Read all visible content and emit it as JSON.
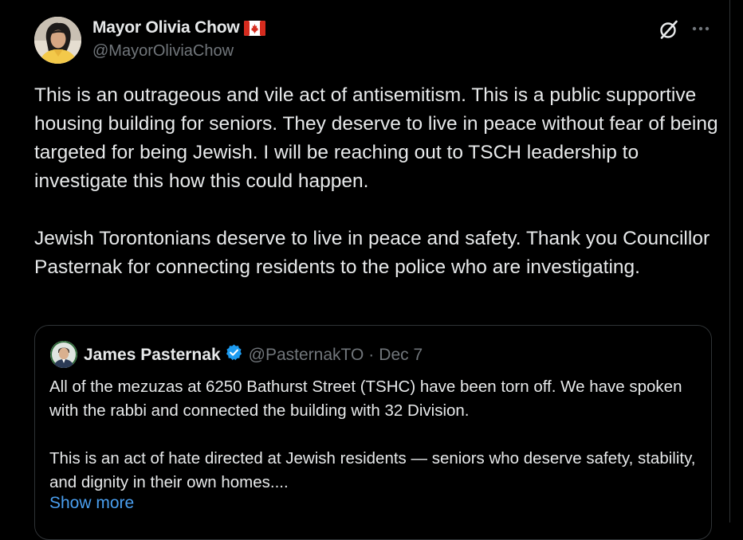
{
  "author": {
    "display_name": "Mayor Olivia Chow",
    "flag_emoji": "canada-flag-icon",
    "handle": "@MayorOliviaChow"
  },
  "tweet": {
    "paragraphs": [
      "This is an outrageous and vile act of antisemitism. This is a public supportive housing building for seniors. They deserve to live in peace without fear of being targeted for being Jewish. I will be reaching out to TSCH leadership to investigate this how this could happen.",
      "Jewish Torontonians deserve to live in peace and safety. Thank you Councillor Pasternak for connecting residents to the police who are investigating."
    ]
  },
  "quote": {
    "display_name": "James Pasternak",
    "handle": "@PasternakTO",
    "separator": "·",
    "date": "Dec 7",
    "paragraphs": [
      "All of the mezuzas at 6250 Bathurst Street (TSHC) have been torn off. We have spoken with the rabbi and connected the building with 32 Division.",
      "This is an act of hate directed at Jewish residents — seniors who deserve safety, stability, and dignity in their own homes...."
    ],
    "show_more_label": "Show more"
  },
  "icons": {
    "grok": "grok-icon",
    "more": "more-icon",
    "verified": "verified-badge-icon"
  },
  "colors": {
    "background": "#000000",
    "text": "#e7e9ea",
    "secondary_text": "#71767b",
    "link": "#4a9ff0",
    "border": "#2f3336",
    "verified": "#1d9bf0"
  }
}
